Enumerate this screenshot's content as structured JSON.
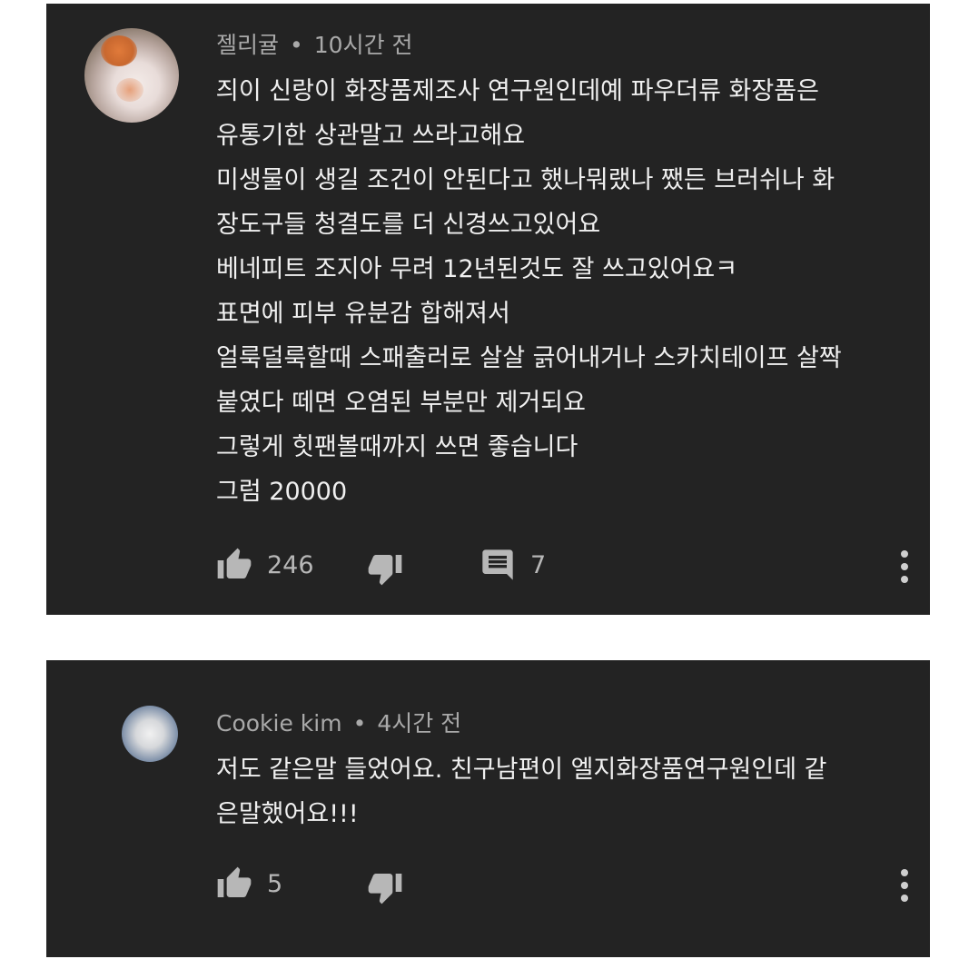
{
  "comments": [
    {
      "author": "젤리귤",
      "separator": "•",
      "time": "10시간 전",
      "lines": [
        "즤이 신랑이 화장품제조사 연구원인데예 파우더류 화장품은",
        "유통기한 상관말고 쓰라고해요",
        "미생물이 생길 조건이 안된다고 했나뭐랬나 쨌든 브러쉬나 화",
        "장도구들 청결도를 더 신경쓰고있어요",
        "베네피트 조지아 무려 12년된것도 잘 쓰고있어요ㅋ",
        "표면에 피부 유분감 합해져서",
        "얼룩덜룩할때 스패출러로 살살 긁어내거나 스카치테이프 살짝",
        "붙였다 떼면 오염된 부분만 제거되요",
        "그렇게 힛팬볼때까지 쓰면 좋습니다",
        "그럼 20000"
      ],
      "likes": "246",
      "replies": "7",
      "avatar_icon": "avatar-photo-icon"
    },
    {
      "author": "Cookie kim",
      "separator": "•",
      "time": "4시간 전",
      "lines": [
        "저도 같은말 들었어요. 친구남편이 엘지화장품연구원인데 같",
        "은말했어요!!!"
      ],
      "likes": "5",
      "avatar_icon": "avatar-photo-icon"
    }
  ],
  "colors": {
    "card_background": "#232323",
    "text_primary": "#f0f0f0",
    "text_secondary": "#a9a9a9"
  },
  "icons": [
    "thumbs-up-icon",
    "thumbs-down-icon",
    "reply-icon",
    "more-vert-icon"
  ]
}
